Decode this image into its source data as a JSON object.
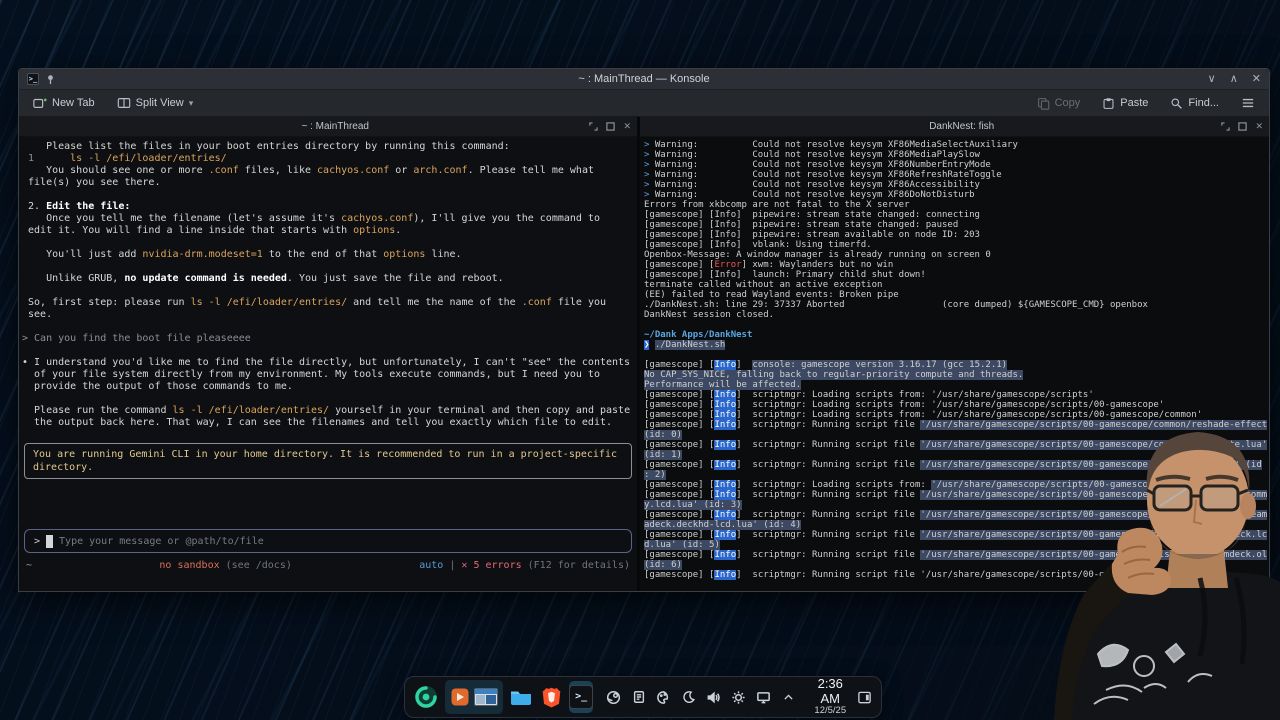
{
  "window": {
    "title": "~ : MainThread — Konsole",
    "toolbar": {
      "new_tab": "New Tab",
      "split_view": "Split View",
      "copy": "Copy",
      "paste": "Paste",
      "find": "Find..."
    }
  },
  "icons": {
    "minimize": "∨",
    "maximize": "∧",
    "close": "✕",
    "caret_down": "▾",
    "chevron_up": "∧",
    "terminal_glyph": ">_"
  },
  "colors": {
    "accent": "#3daee9",
    "code_orange": "#dba45c",
    "error_red": "#e06c75",
    "info_blue_bg": "#2a66cc",
    "selection": "#3d4962",
    "sandbox_warn": "#d9705c"
  },
  "left_pane": {
    "title": "~ : MainThread",
    "lines": [
      [
        {
          "t": "    Please list the files in your boot entries directory by running this command:"
        }
      ],
      [
        {
          "t": " 1 ",
          "c": "dim"
        },
        {
          "t": "     ls -l /efi/loader/entries/",
          "c": "code"
        }
      ],
      [
        {
          "t": "    You should see one or more "
        },
        {
          "t": ".conf",
          "c": "code"
        },
        {
          "t": " files, like "
        },
        {
          "t": "cachyos.conf",
          "c": "code"
        },
        {
          "t": " or "
        },
        {
          "t": "arch.conf",
          "c": "code"
        },
        {
          "t": ". Please tell me what"
        }
      ],
      [
        {
          "t": " file(s) you see there."
        }
      ],
      [],
      [
        {
          "t": " 2. "
        },
        {
          "t": "Edit the file:",
          "c": "b"
        }
      ],
      [
        {
          "t": "    Once you tell me the filename (let's assume it's "
        },
        {
          "t": "cachyos.conf",
          "c": "code"
        },
        {
          "t": "), I'll give you the command to"
        }
      ],
      [
        {
          "t": " edit it. You will find a line inside that starts with "
        },
        {
          "t": "options",
          "c": "code"
        },
        {
          "t": "."
        }
      ],
      [],
      [
        {
          "t": "    You'll just add "
        },
        {
          "t": "nvidia-drm.modeset=1",
          "c": "code"
        },
        {
          "t": " to the end of that "
        },
        {
          "t": "options",
          "c": "code"
        },
        {
          "t": " line."
        }
      ],
      [],
      [
        {
          "t": "    Unlike GRUB, "
        },
        {
          "t": "no update command is needed",
          "c": "b"
        },
        {
          "t": ". You just save the file and reboot."
        }
      ],
      [],
      [
        {
          "t": " So, first step: please run "
        },
        {
          "t": "ls -l /efi/loader/entries/",
          "c": "code"
        },
        {
          "t": " and tell me the name of the "
        },
        {
          "t": ".conf",
          "c": "code"
        },
        {
          "t": " file you"
        }
      ],
      [
        {
          "t": " see."
        }
      ],
      [],
      [
        {
          "t": "> Can you find the boot file pleaseeee",
          "c": "dim"
        }
      ],
      [],
      [
        {
          "t": "• I understand you'd like me to find the file directly, but unfortunately, I can't \"see\" the contents"
        }
      ],
      [
        {
          "t": "  of your file system directly from my environment. My tools execute commands, but I need you to"
        }
      ],
      [
        {
          "t": "  provide the output of those commands to me."
        }
      ],
      [],
      [
        {
          "t": "  Please run the command "
        },
        {
          "t": "ls -l /efi/loader/entries/",
          "c": "code"
        },
        {
          "t": " yourself in your terminal and then copy and paste"
        }
      ],
      [
        {
          "t": "  the output back here. That way, I can see the filenames and tell you exactly which file to edit."
        }
      ]
    ],
    "notice": "You are running Gemini CLI in your home directory. It is recommended to run in a project-specific directory.",
    "input": {
      "prompt": ">",
      "placeholder": "Type your message or @path/to/file"
    },
    "status": {
      "path": "~",
      "sandbox": "no sandbox",
      "sandbox_hint": " (see /docs)",
      "model": "auto",
      "pipe": " | ",
      "errors": "✕ 5 errors",
      "errors_hint": " (F12 for details)"
    }
  },
  "right_pane": {
    "title": "DankNest: fish",
    "lines": [
      [
        {
          "t": "> ",
          "c": "p"
        },
        {
          "t": "Warning:          Could not resolve keysym XF86MediaSelectAuxiliary"
        }
      ],
      [
        {
          "t": "> ",
          "c": "p"
        },
        {
          "t": "Warning:          Could not resolve keysym XF86MediaPlaySlow"
        }
      ],
      [
        {
          "t": "> ",
          "c": "p"
        },
        {
          "t": "Warning:          Could not resolve keysym XF86NumberEntryMode"
        }
      ],
      [
        {
          "t": "> ",
          "c": "p"
        },
        {
          "t": "Warning:          Could not resolve keysym XF86RefreshRateToggle"
        }
      ],
      [
        {
          "t": "> ",
          "c": "p"
        },
        {
          "t": "Warning:          Could not resolve keysym XF86Accessibility"
        }
      ],
      [
        {
          "t": "> ",
          "c": "p"
        },
        {
          "t": "Warning:          Could not resolve keysym XF86DoNotDisturb"
        }
      ],
      [
        {
          "t": "Errors from xkbcomp are not fatal to the X server"
        }
      ],
      [
        {
          "t": "[gamescope] [Info]  pipewire: stream state changed: connecting"
        }
      ],
      [
        {
          "t": "[gamescope] [Info]  pipewire: stream state changed: paused"
        }
      ],
      [
        {
          "t": "[gamescope] [Info]  pipewire: stream available on node ID: 203"
        }
      ],
      [
        {
          "t": "[gamescope] [Info]  vblank: Using timerfd."
        }
      ],
      [
        {
          "t": "Openbox-Message: A window manager is already running on screen 0"
        }
      ],
      [
        {
          "t": "[gamescope] ["
        },
        {
          "t": "Error",
          "c": "err"
        },
        {
          "t": "] xwm: Waylanders but no win"
        }
      ],
      [
        {
          "t": "[gamescope] [Info]  launch: Primary child shut down!"
        }
      ],
      [
        {
          "t": "terminate called without an active exception"
        }
      ],
      [
        {
          "t": "(EE) failed to read Wayland events: Broken pipe"
        }
      ],
      [
        {
          "t": "./DankNest.sh: line 29: 37337 Aborted                  (core dumped) ${GAMESCOPE_CMD} openbox"
        }
      ],
      [
        {
          "t": "DankNest session closed."
        }
      ],
      [],
      [
        {
          "t": "~/Dank Apps/DankNest",
          "c": "path"
        }
      ],
      [
        {
          "t": "❯",
          "c": "pblk"
        },
        {
          "t": " "
        },
        {
          "t": "./DankNest.sh",
          "c": "sel"
        }
      ],
      [],
      [
        {
          "t": "[gamescope] ["
        },
        {
          "t": "Info",
          "c": "infob"
        },
        {
          "t": "]  "
        },
        {
          "t": "console: gamescope version 3.16.17 (gcc 15.2.1)",
          "c": "sel"
        }
      ],
      [
        {
          "t": "No CAP_SYS_NICE, falling back to regular-priority compute and threads.",
          "c": "sel"
        }
      ],
      [
        {
          "t": "Performance will be affected.",
          "c": "sel"
        }
      ],
      [
        {
          "t": "[gamescope] ["
        },
        {
          "t": "Info",
          "c": "infob"
        },
        {
          "t": "]  scriptmgr: Loading scripts from: '/usr/share/gamescope/scripts'"
        }
      ],
      [
        {
          "t": "[gamescope] ["
        },
        {
          "t": "Info",
          "c": "infob"
        },
        {
          "t": "]  scriptmgr: Loading scripts from: '/usr/share/gamescope/scripts/00-gamescope'"
        }
      ],
      [
        {
          "t": "[gamescope] ["
        },
        {
          "t": "Info",
          "c": "infob"
        },
        {
          "t": "]  scriptmgr: Loading scripts from: '/usr/share/gamescope/scripts/00-gamescope/common'"
        }
      ],
      [
        {
          "t": "[gamescope] ["
        },
        {
          "t": "Info",
          "c": "infob"
        },
        {
          "t": "]  scriptmgr: Running script file "
        },
        {
          "t": "'/usr/share/gamescope/scripts/00-gamescope/common/reshade-effect.lua'",
          "c": "sel"
        }
      ],
      [
        {
          "t": "(id: 0)",
          "c": "sel"
        }
      ],
      [
        {
          "t": "[gamescope] ["
        },
        {
          "t": "Info",
          "c": "infob"
        },
        {
          "t": "]  scriptmgr: Running script file "
        },
        {
          "t": "'/usr/share/gamescope/scripts/00-gamescope/common/baseplate.lua'",
          "c": "sel"
        }
      ],
      [
        {
          "t": "(id: 1)",
          "c": "sel"
        }
      ],
      [
        {
          "t": "[gamescope] ["
        },
        {
          "t": "Info",
          "c": "infob"
        },
        {
          "t": "]  scriptmgr: Running script file "
        },
        {
          "t": "'/usr/share/gamescope/scripts/00-gamescope/common/util.lua' (id",
          "c": "sel"
        }
      ],
      [
        {
          "t": ": 2)",
          "c": "sel"
        }
      ],
      [
        {
          "t": "[gamescope] ["
        },
        {
          "t": "Info",
          "c": "infob"
        },
        {
          "t": "]  scriptmgr: Loading scripts from: "
        },
        {
          "t": "'/usr/share/gamescope/scripts/00-gamescope/displays'",
          "c": "sel"
        }
      ],
      [
        {
          "t": "[gamescope] ["
        },
        {
          "t": "Info",
          "c": "infob"
        },
        {
          "t": "]  scriptmgr: Running script file "
        },
        {
          "t": "'/usr/share/gamescope/scripts/00-gamescope/displays/galileo.communit",
          "c": "sel"
        }
      ],
      [
        {
          "t": "y.lcd.lua' (id: 3)",
          "c": "sel"
        }
      ],
      [
        {
          "t": "[gamescope] ["
        },
        {
          "t": "Info",
          "c": "infob"
        },
        {
          "t": "]  scriptmgr: Running script file "
        },
        {
          "t": "'/usr/share/gamescope/scripts/00-gamescope/displays/deckhd.steam",
          "c": "sel"
        }
      ],
      [
        {
          "t": "adeck.deckhd-lcd.lua' (id: 4)",
          "c": "sel"
        }
      ],
      [
        {
          "t": "[gamescope] ["
        },
        {
          "t": "Info",
          "c": "infob"
        },
        {
          "t": "]  scriptmgr: Running script file "
        },
        {
          "t": "'/usr/share/gamescope/scripts/00-gamescope/displays/steamdeck.lc",
          "c": "sel"
        }
      ],
      [
        {
          "t": "d.lua' (id: 5)",
          "c": "sel"
        }
      ],
      [
        {
          "t": "[gamescope] ["
        },
        {
          "t": "Info",
          "c": "infob"
        },
        {
          "t": "]  scriptmgr: Running script file "
        },
        {
          "t": "'/usr/share/gamescope/scripts/00-gamescope/displays/steamdeck.ol",
          "c": "sel"
        }
      ],
      [
        {
          "t": "(id: 6)",
          "c": "sel"
        }
      ],
      [
        {
          "t": "[gamescope] ["
        },
        {
          "t": "Info",
          "c": "infob"
        },
        {
          "t": "]  scriptmgr: Running script file '/usr/share/gamescope/scripts/00-g"
        }
      ]
    ]
  },
  "taskbar": {
    "time": "2:36 AM",
    "date": "12/5/25"
  }
}
